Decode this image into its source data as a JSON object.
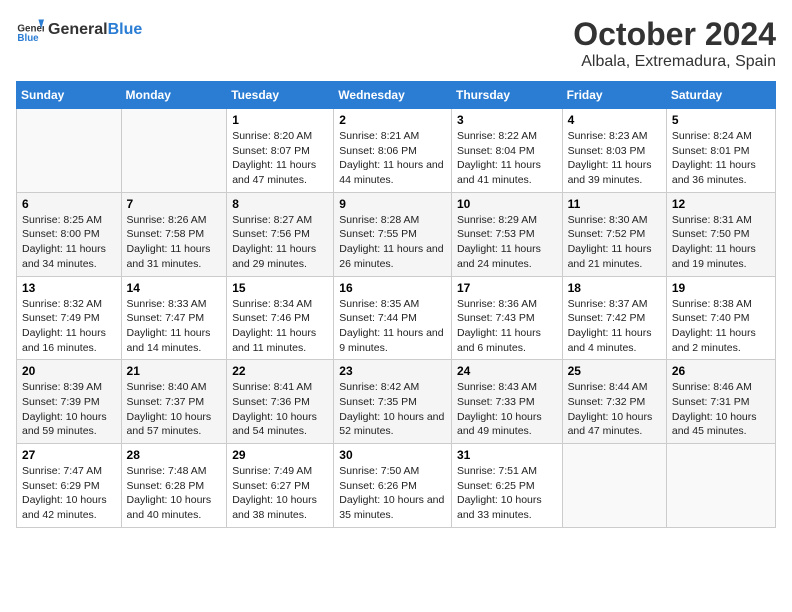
{
  "header": {
    "logo_general": "General",
    "logo_blue": "Blue",
    "month_title": "October 2024",
    "location": "Albala, Extremadura, Spain"
  },
  "weekdays": [
    "Sunday",
    "Monday",
    "Tuesday",
    "Wednesday",
    "Thursday",
    "Friday",
    "Saturday"
  ],
  "weeks": [
    [
      {
        "day": "",
        "info": ""
      },
      {
        "day": "",
        "info": ""
      },
      {
        "day": "1",
        "info": "Sunrise: 8:20 AM\nSunset: 8:07 PM\nDaylight: 11 hours and 47 minutes."
      },
      {
        "day": "2",
        "info": "Sunrise: 8:21 AM\nSunset: 8:06 PM\nDaylight: 11 hours and 44 minutes."
      },
      {
        "day": "3",
        "info": "Sunrise: 8:22 AM\nSunset: 8:04 PM\nDaylight: 11 hours and 41 minutes."
      },
      {
        "day": "4",
        "info": "Sunrise: 8:23 AM\nSunset: 8:03 PM\nDaylight: 11 hours and 39 minutes."
      },
      {
        "day": "5",
        "info": "Sunrise: 8:24 AM\nSunset: 8:01 PM\nDaylight: 11 hours and 36 minutes."
      }
    ],
    [
      {
        "day": "6",
        "info": "Sunrise: 8:25 AM\nSunset: 8:00 PM\nDaylight: 11 hours and 34 minutes."
      },
      {
        "day": "7",
        "info": "Sunrise: 8:26 AM\nSunset: 7:58 PM\nDaylight: 11 hours and 31 minutes."
      },
      {
        "day": "8",
        "info": "Sunrise: 8:27 AM\nSunset: 7:56 PM\nDaylight: 11 hours and 29 minutes."
      },
      {
        "day": "9",
        "info": "Sunrise: 8:28 AM\nSunset: 7:55 PM\nDaylight: 11 hours and 26 minutes."
      },
      {
        "day": "10",
        "info": "Sunrise: 8:29 AM\nSunset: 7:53 PM\nDaylight: 11 hours and 24 minutes."
      },
      {
        "day": "11",
        "info": "Sunrise: 8:30 AM\nSunset: 7:52 PM\nDaylight: 11 hours and 21 minutes."
      },
      {
        "day": "12",
        "info": "Sunrise: 8:31 AM\nSunset: 7:50 PM\nDaylight: 11 hours and 19 minutes."
      }
    ],
    [
      {
        "day": "13",
        "info": "Sunrise: 8:32 AM\nSunset: 7:49 PM\nDaylight: 11 hours and 16 minutes."
      },
      {
        "day": "14",
        "info": "Sunrise: 8:33 AM\nSunset: 7:47 PM\nDaylight: 11 hours and 14 minutes."
      },
      {
        "day": "15",
        "info": "Sunrise: 8:34 AM\nSunset: 7:46 PM\nDaylight: 11 hours and 11 minutes."
      },
      {
        "day": "16",
        "info": "Sunrise: 8:35 AM\nSunset: 7:44 PM\nDaylight: 11 hours and 9 minutes."
      },
      {
        "day": "17",
        "info": "Sunrise: 8:36 AM\nSunset: 7:43 PM\nDaylight: 11 hours and 6 minutes."
      },
      {
        "day": "18",
        "info": "Sunrise: 8:37 AM\nSunset: 7:42 PM\nDaylight: 11 hours and 4 minutes."
      },
      {
        "day": "19",
        "info": "Sunrise: 8:38 AM\nSunset: 7:40 PM\nDaylight: 11 hours and 2 minutes."
      }
    ],
    [
      {
        "day": "20",
        "info": "Sunrise: 8:39 AM\nSunset: 7:39 PM\nDaylight: 10 hours and 59 minutes."
      },
      {
        "day": "21",
        "info": "Sunrise: 8:40 AM\nSunset: 7:37 PM\nDaylight: 10 hours and 57 minutes."
      },
      {
        "day": "22",
        "info": "Sunrise: 8:41 AM\nSunset: 7:36 PM\nDaylight: 10 hours and 54 minutes."
      },
      {
        "day": "23",
        "info": "Sunrise: 8:42 AM\nSunset: 7:35 PM\nDaylight: 10 hours and 52 minutes."
      },
      {
        "day": "24",
        "info": "Sunrise: 8:43 AM\nSunset: 7:33 PM\nDaylight: 10 hours and 49 minutes."
      },
      {
        "day": "25",
        "info": "Sunrise: 8:44 AM\nSunset: 7:32 PM\nDaylight: 10 hours and 47 minutes."
      },
      {
        "day": "26",
        "info": "Sunrise: 8:46 AM\nSunset: 7:31 PM\nDaylight: 10 hours and 45 minutes."
      }
    ],
    [
      {
        "day": "27",
        "info": "Sunrise: 7:47 AM\nSunset: 6:29 PM\nDaylight: 10 hours and 42 minutes."
      },
      {
        "day": "28",
        "info": "Sunrise: 7:48 AM\nSunset: 6:28 PM\nDaylight: 10 hours and 40 minutes."
      },
      {
        "day": "29",
        "info": "Sunrise: 7:49 AM\nSunset: 6:27 PM\nDaylight: 10 hours and 38 minutes."
      },
      {
        "day": "30",
        "info": "Sunrise: 7:50 AM\nSunset: 6:26 PM\nDaylight: 10 hours and 35 minutes."
      },
      {
        "day": "31",
        "info": "Sunrise: 7:51 AM\nSunset: 6:25 PM\nDaylight: 10 hours and 33 minutes."
      },
      {
        "day": "",
        "info": ""
      },
      {
        "day": "",
        "info": ""
      }
    ]
  ]
}
